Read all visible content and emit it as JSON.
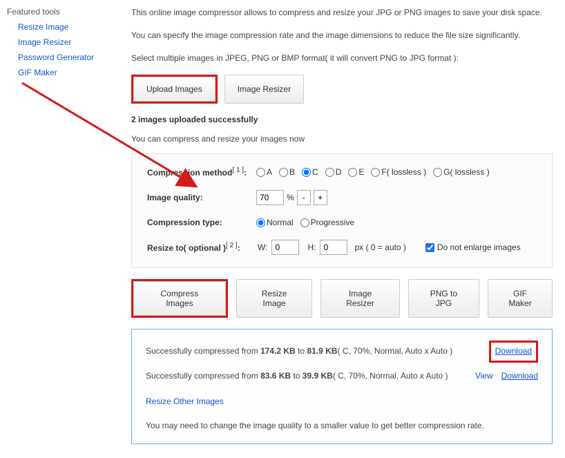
{
  "sidebar": {
    "title": "Featured tools",
    "items": [
      {
        "label": "Resize Image"
      },
      {
        "label": "Image Resizer"
      },
      {
        "label": "Password Generator"
      },
      {
        "label": "GIF Maker"
      }
    ]
  },
  "intro": {
    "p1": "This online image compressor allows to compress and resize your JPG or PNG images to save your disk space.",
    "p2": "You can specify the image compression rate and the image dimensions to reduce the file size significantly.",
    "p3": "Select multiple images in JPEG, PNG or BMP format( it will convert PNG to JPG format ):"
  },
  "topButtons": {
    "upload": "Upload Images",
    "resizer": "Image Resizer"
  },
  "status": "2 images uploaded successfully",
  "hint": "You can compress and resize your images now",
  "options": {
    "method": {
      "label": "Compression method",
      "sup": "[ 1 ]",
      "colon": ":",
      "choices": [
        "A",
        "B",
        "C",
        "D",
        "E",
        "F( lossless )",
        "G( lossless )"
      ],
      "selected": "C"
    },
    "quality": {
      "label": "Image quality:",
      "value": "70",
      "percent": "%",
      "minus": "-",
      "plus": "+"
    },
    "type": {
      "label": "Compression type:",
      "normal": "Normal",
      "progressive": "Progressive",
      "selected": "Normal"
    },
    "resize": {
      "label": "Resize to( optional )",
      "sup": "[ 2 ]",
      "colon": ":",
      "wlabel": "W:",
      "wvalue": "0",
      "hlabel": "H:",
      "hvalue": "0",
      "pxnote": "px ( 0 = auto )",
      "enlarge_label": "Do not enlarge images",
      "enlarge_checked": true
    }
  },
  "actionButtons": {
    "compress": "Compress Images",
    "resize": "Resize Image",
    "resizer": "Image Resizer",
    "png2jpg": "PNG to JPG",
    "gif": "GIF Maker"
  },
  "results": {
    "line1": {
      "prefix": "Successfully compressed from ",
      "from": "174.2 KB",
      "mid": " to ",
      "to": "81.9 KB",
      "suffix": "( C, 70%, Normal, Auto x Auto )",
      "download": "Download"
    },
    "line2": {
      "prefix": "Successfully compressed from ",
      "from": "83.6 KB",
      "mid": " to ",
      "to": "39.9 KB",
      "suffix": "( C, 70%, Normal, Auto x Auto )",
      "view": "View",
      "download": "Download"
    },
    "resize_other": "Resize Other Images",
    "note": "You may need to change the image quality to a smaller value to get better compression rate."
  }
}
